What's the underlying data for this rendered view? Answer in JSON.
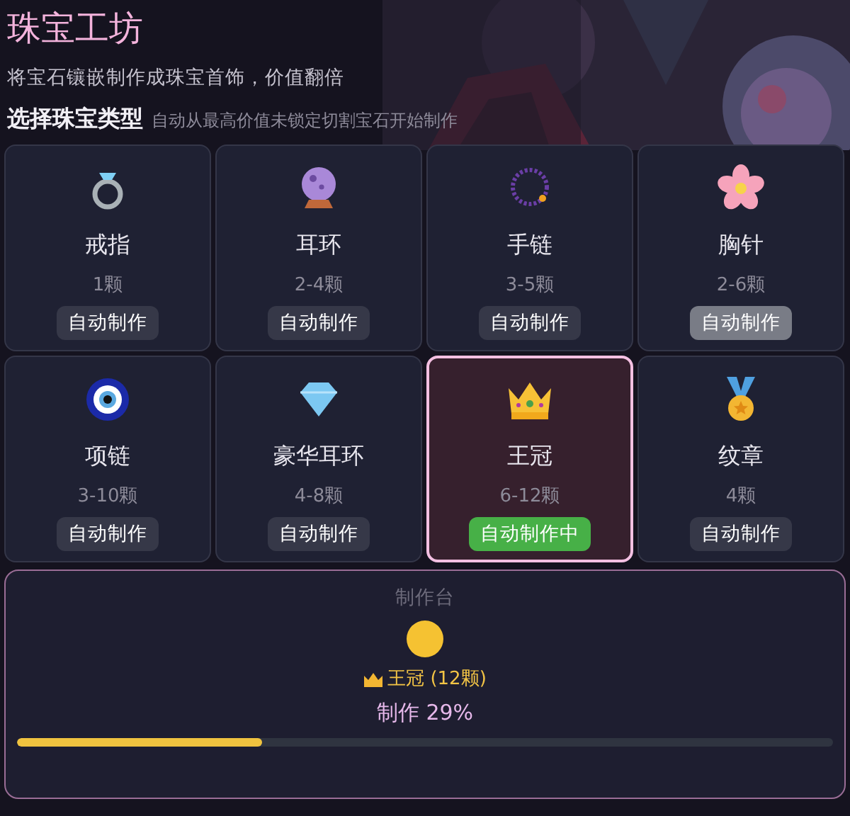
{
  "header": {
    "title": "珠宝工坊",
    "subtitle": "将宝石镶嵌制作成珠宝首饰，价值翻倍",
    "section_title": "选择珠宝类型",
    "section_hint": "自动从最高价值未锁定切割宝石开始制作"
  },
  "items": [
    {
      "kind": "ring",
      "name": "戒指",
      "count": "1颗",
      "button": "自动制作",
      "selected": false,
      "hovered": false
    },
    {
      "kind": "orb",
      "name": "耳环",
      "count": "2-4颗",
      "button": "自动制作",
      "selected": false,
      "hovered": false
    },
    {
      "kind": "beads",
      "name": "手链",
      "count": "3-5颗",
      "button": "自动制作",
      "selected": false,
      "hovered": false
    },
    {
      "kind": "blossom",
      "name": "胸针",
      "count": "2-6颗",
      "button": "自动制作",
      "selected": false,
      "hovered": true
    },
    {
      "kind": "eye",
      "name": "项链",
      "count": "3-10颗",
      "button": "自动制作",
      "selected": false,
      "hovered": false
    },
    {
      "kind": "diamond",
      "name": "豪华耳环",
      "count": "4-8颗",
      "button": "自动制作",
      "selected": false,
      "hovered": false
    },
    {
      "kind": "crown",
      "name": "王冠",
      "count": "6-12颗",
      "button": "自动制作中",
      "selected": true,
      "hovered": false
    },
    {
      "kind": "medal",
      "name": "纹章",
      "count": "4颗",
      "button": "自动制作",
      "selected": false,
      "hovered": false
    }
  ],
  "bench": {
    "title": "制作台",
    "product": "王冠 (12颗)",
    "progress_text": "制作 29%",
    "level": 0.3
  }
}
